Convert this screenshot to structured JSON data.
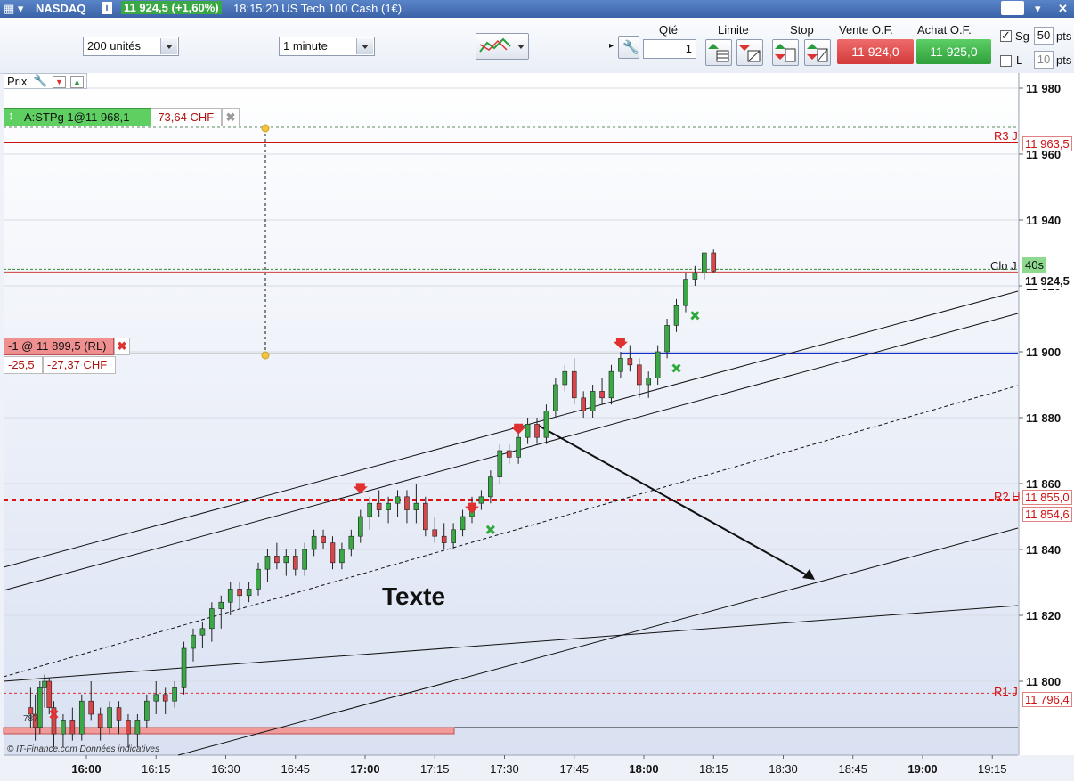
{
  "titlebar": {
    "instrument": "NASDAQ",
    "info_icon": "info-icon",
    "quote": "11 924,5 (+1,60%)",
    "time_desc": "18:15:20 US Tech 100 Cash (1€)"
  },
  "toolbar": {
    "units_select": "200 unités",
    "interval_select": "1 minute",
    "qty_label": "Qté",
    "qty_value": "1",
    "limit_label": "Limite",
    "stop_label": "Stop",
    "sell_label": "Vente O.F.",
    "sell_value": "11 924,0",
    "buy_label": "Achat O.F.",
    "buy_value": "11 925,0",
    "sg_label": "Sg",
    "sg_value": "50",
    "sg_unit": "pts",
    "l_label": "L",
    "l_value": "10",
    "l_unit": "pts"
  },
  "panel": {
    "prix_label": "Prix"
  },
  "orders": {
    "stop_order": "A:STPg 1@11 968,1",
    "stop_pnl": "-73,64 CHF",
    "position": "-1 @ 11 899,5 (RL)",
    "position_pts": "-25,5",
    "position_pnl": "-27,37 CHF"
  },
  "annotations": {
    "text_note": "Texte",
    "r3_label": "R3 J",
    "r3_value": "11 963,5",
    "clo_label": "Clo J",
    "countdown": "40s",
    "last_price": "11 924,5",
    "r2_label": "R2 H",
    "r2_value": "11 855,0",
    "r2b_value": "11 854,6",
    "r1_label": "R1 J",
    "r1_value": "11 796,4",
    "credit": "© IT-Finance.com Données indicatives",
    "low_label": "787"
  },
  "colors": {
    "up": "#3aa845",
    "down": "#d9464a",
    "resistance": "#e01010",
    "support_blue": "#1030d0",
    "bg": "#eef1f7"
  },
  "chart_data": {
    "type": "candlestick",
    "title": "NASDAQ 1 minute",
    "ylim": [
      11780,
      11985
    ],
    "yticks": [
      "11 980",
      "11 960",
      "11 940",
      "11 920",
      "11 900",
      "11 880",
      "11 860",
      "11 840",
      "11 820",
      "11 800"
    ],
    "ytick_values": [
      11980,
      11960,
      11940,
      11920,
      11900,
      11880,
      11860,
      11840,
      11820,
      11800
    ],
    "xticks": [
      "16:00",
      "16:15",
      "16:30",
      "16:45",
      "17:00",
      "17:15",
      "17:30",
      "17:45",
      "18:00",
      "18:15",
      "18:30",
      "18:45",
      "19:00",
      "19:15"
    ],
    "xtick_bold": [
      "16:00",
      "17:00",
      "18:00",
      "19:00"
    ],
    "xrange_minutes": [
      "15:47",
      "19:20"
    ],
    "last_price": 11924.5,
    "levels": {
      "r3": 11963.5,
      "close_prev": 11924.5,
      "position": 11899.5,
      "r2": 11855.0,
      "r1": 11796.4,
      "stop_order": 11968.1
    },
    "candles": [
      {
        "t": "15:48",
        "o": 11792,
        "h": 11798,
        "l": 11786,
        "c": 11790
      },
      {
        "t": "15:49",
        "o": 11790,
        "h": 11796,
        "l": 11782,
        "c": 11786
      },
      {
        "t": "15:50",
        "o": 11786,
        "h": 11800,
        "l": 11784,
        "c": 11798
      },
      {
        "t": "15:51",
        "o": 11798,
        "h": 11802,
        "l": 11792,
        "c": 11800
      },
      {
        "t": "15:52",
        "o": 11800,
        "h": 11801,
        "l": 11790,
        "c": 11792
      },
      {
        "t": "15:53",
        "o": 11792,
        "h": 11794,
        "l": 11780,
        "c": 11784
      },
      {
        "t": "15:55",
        "o": 11784,
        "h": 11790,
        "l": 11780,
        "c": 11788
      },
      {
        "t": "15:57",
        "o": 11788,
        "h": 11792,
        "l": 11782,
        "c": 11784
      },
      {
        "t": "15:59",
        "o": 11784,
        "h": 11796,
        "l": 11782,
        "c": 11794
      },
      {
        "t": "16:01",
        "o": 11794,
        "h": 11800,
        "l": 11788,
        "c": 11790
      },
      {
        "t": "16:03",
        "o": 11790,
        "h": 11792,
        "l": 11782,
        "c": 11786
      },
      {
        "t": "16:05",
        "o": 11786,
        "h": 11794,
        "l": 11784,
        "c": 11792
      },
      {
        "t": "16:07",
        "o": 11792,
        "h": 11794,
        "l": 11784,
        "c": 11788
      },
      {
        "t": "16:09",
        "o": 11788,
        "h": 11790,
        "l": 11780,
        "c": 11784
      },
      {
        "t": "16:11",
        "o": 11784,
        "h": 11790,
        "l": 11780,
        "c": 11788
      },
      {
        "t": "16:13",
        "o": 11788,
        "h": 11796,
        "l": 11786,
        "c": 11794
      },
      {
        "t": "16:15",
        "o": 11794,
        "h": 11800,
        "l": 11790,
        "c": 11796
      },
      {
        "t": "16:17",
        "o": 11796,
        "h": 11798,
        "l": 11790,
        "c": 11794
      },
      {
        "t": "16:19",
        "o": 11794,
        "h": 11800,
        "l": 11792,
        "c": 11798
      },
      {
        "t": "16:21",
        "o": 11798,
        "h": 11812,
        "l": 11796,
        "c": 11810
      },
      {
        "t": "16:23",
        "o": 11810,
        "h": 11816,
        "l": 11806,
        "c": 11814
      },
      {
        "t": "16:25",
        "o": 11814,
        "h": 11818,
        "l": 11810,
        "c": 11816
      },
      {
        "t": "16:27",
        "o": 11816,
        "h": 11824,
        "l": 11812,
        "c": 11822
      },
      {
        "t": "16:29",
        "o": 11822,
        "h": 11826,
        "l": 11816,
        "c": 11824
      },
      {
        "t": "16:31",
        "o": 11824,
        "h": 11830,
        "l": 11820,
        "c": 11828
      },
      {
        "t": "16:33",
        "o": 11828,
        "h": 11830,
        "l": 11822,
        "c": 11826
      },
      {
        "t": "16:35",
        "o": 11826,
        "h": 11830,
        "l": 11824,
        "c": 11828
      },
      {
        "t": "16:37",
        "o": 11828,
        "h": 11836,
        "l": 11826,
        "c": 11834
      },
      {
        "t": "16:39",
        "o": 11834,
        "h": 11840,
        "l": 11830,
        "c": 11838
      },
      {
        "t": "16:41",
        "o": 11838,
        "h": 11842,
        "l": 11834,
        "c": 11836
      },
      {
        "t": "16:43",
        "o": 11836,
        "h": 11840,
        "l": 11832,
        "c": 11838
      },
      {
        "t": "16:45",
        "o": 11838,
        "h": 11840,
        "l": 11832,
        "c": 11834
      },
      {
        "t": "16:47",
        "o": 11834,
        "h": 11842,
        "l": 11832,
        "c": 11840
      },
      {
        "t": "16:49",
        "o": 11840,
        "h": 11846,
        "l": 11838,
        "c": 11844
      },
      {
        "t": "16:51",
        "o": 11844,
        "h": 11846,
        "l": 11840,
        "c": 11842
      },
      {
        "t": "16:53",
        "o": 11842,
        "h": 11844,
        "l": 11834,
        "c": 11836
      },
      {
        "t": "16:55",
        "o": 11836,
        "h": 11842,
        "l": 11834,
        "c": 11840
      },
      {
        "t": "16:57",
        "o": 11840,
        "h": 11846,
        "l": 11838,
        "c": 11844
      },
      {
        "t": "16:59",
        "o": 11844,
        "h": 11852,
        "l": 11842,
        "c": 11850
      },
      {
        "t": "17:01",
        "o": 11850,
        "h": 11856,
        "l": 11846,
        "c": 11854
      },
      {
        "t": "17:03",
        "o": 11854,
        "h": 11858,
        "l": 11850,
        "c": 11852
      },
      {
        "t": "17:05",
        "o": 11852,
        "h": 11856,
        "l": 11848,
        "c": 11854
      },
      {
        "t": "17:07",
        "o": 11854,
        "h": 11858,
        "l": 11850,
        "c": 11856
      },
      {
        "t": "17:09",
        "o": 11856,
        "h": 11858,
        "l": 11848,
        "c": 11852
      },
      {
        "t": "17:11",
        "o": 11852,
        "h": 11860,
        "l": 11848,
        "c": 11854
      },
      {
        "t": "17:13",
        "o": 11854,
        "h": 11856,
        "l": 11844,
        "c": 11846
      },
      {
        "t": "17:15",
        "o": 11846,
        "h": 11850,
        "l": 11842,
        "c": 11844
      },
      {
        "t": "17:17",
        "o": 11844,
        "h": 11848,
        "l": 11840,
        "c": 11842
      },
      {
        "t": "17:19",
        "o": 11842,
        "h": 11848,
        "l": 11840,
        "c": 11846
      },
      {
        "t": "17:21",
        "o": 11846,
        "h": 11852,
        "l": 11844,
        "c": 11850
      },
      {
        "t": "17:23",
        "o": 11850,
        "h": 11856,
        "l": 11848,
        "c": 11854
      },
      {
        "t": "17:25",
        "o": 11854,
        "h": 11858,
        "l": 11852,
        "c": 11856
      },
      {
        "t": "17:27",
        "o": 11856,
        "h": 11864,
        "l": 11854,
        "c": 11862
      },
      {
        "t": "17:29",
        "o": 11862,
        "h": 11872,
        "l": 11860,
        "c": 11870
      },
      {
        "t": "17:31",
        "o": 11870,
        "h": 11872,
        "l": 11866,
        "c": 11868
      },
      {
        "t": "17:33",
        "o": 11868,
        "h": 11876,
        "l": 11866,
        "c": 11874
      },
      {
        "t": "17:35",
        "o": 11874,
        "h": 11880,
        "l": 11872,
        "c": 11878
      },
      {
        "t": "17:37",
        "o": 11878,
        "h": 11880,
        "l": 11872,
        "c": 11874
      },
      {
        "t": "17:39",
        "o": 11874,
        "h": 11884,
        "l": 11872,
        "c": 11882
      },
      {
        "t": "17:41",
        "o": 11882,
        "h": 11892,
        "l": 11880,
        "c": 11890
      },
      {
        "t": "17:43",
        "o": 11890,
        "h": 11896,
        "l": 11888,
        "c": 11894
      },
      {
        "t": "17:45",
        "o": 11894,
        "h": 11898,
        "l": 11884,
        "c": 11886
      },
      {
        "t": "17:47",
        "o": 11886,
        "h": 11888,
        "l": 11880,
        "c": 11882
      },
      {
        "t": "17:49",
        "o": 11882,
        "h": 11890,
        "l": 11880,
        "c": 11888
      },
      {
        "t": "17:51",
        "o": 11888,
        "h": 11892,
        "l": 11884,
        "c": 11886
      },
      {
        "t": "17:53",
        "o": 11886,
        "h": 11896,
        "l": 11884,
        "c": 11894
      },
      {
        "t": "17:55",
        "o": 11894,
        "h": 11900,
        "l": 11892,
        "c": 11898
      },
      {
        "t": "17:57",
        "o": 11898,
        "h": 11902,
        "l": 11894,
        "c": 11896
      },
      {
        "t": "17:59",
        "o": 11896,
        "h": 11898,
        "l": 11886,
        "c": 11890
      },
      {
        "t": "18:01",
        "o": 11890,
        "h": 11894,
        "l": 11886,
        "c": 11892
      },
      {
        "t": "18:03",
        "o": 11892,
        "h": 11902,
        "l": 11890,
        "c": 11900
      },
      {
        "t": "18:05",
        "o": 11900,
        "h": 11910,
        "l": 11898,
        "c": 11908
      },
      {
        "t": "18:07",
        "o": 11908,
        "h": 11916,
        "l": 11906,
        "c": 11914
      },
      {
        "t": "18:09",
        "o": 11914,
        "h": 11924,
        "l": 11912,
        "c": 11922
      },
      {
        "t": "18:11",
        "o": 11922,
        "h": 11926,
        "l": 11920,
        "c": 11924
      },
      {
        "t": "18:13",
        "o": 11924,
        "h": 11930,
        "l": 11922,
        "c": 11930
      },
      {
        "t": "18:15",
        "o": 11930,
        "h": 11931,
        "l": 11924,
        "c": 11924.5
      }
    ],
    "markers": [
      {
        "t": "16:59",
        "price": 11858,
        "kind": "sell-arrow"
      },
      {
        "t": "17:23",
        "price": 11852,
        "kind": "sell-arrow"
      },
      {
        "t": "17:33",
        "price": 11876,
        "kind": "sell-arrow"
      },
      {
        "t": "17:55",
        "price": 11902,
        "kind": "sell-arrow"
      },
      {
        "t": "17:27",
        "price": 11846,
        "kind": "buy-cross"
      },
      {
        "t": "18:07",
        "price": 11895,
        "kind": "buy-cross"
      },
      {
        "t": "18:11",
        "price": 11911,
        "kind": "buy-cross"
      },
      {
        "t": "15:53",
        "price": 11790,
        "kind": "close-cross"
      }
    ]
  }
}
